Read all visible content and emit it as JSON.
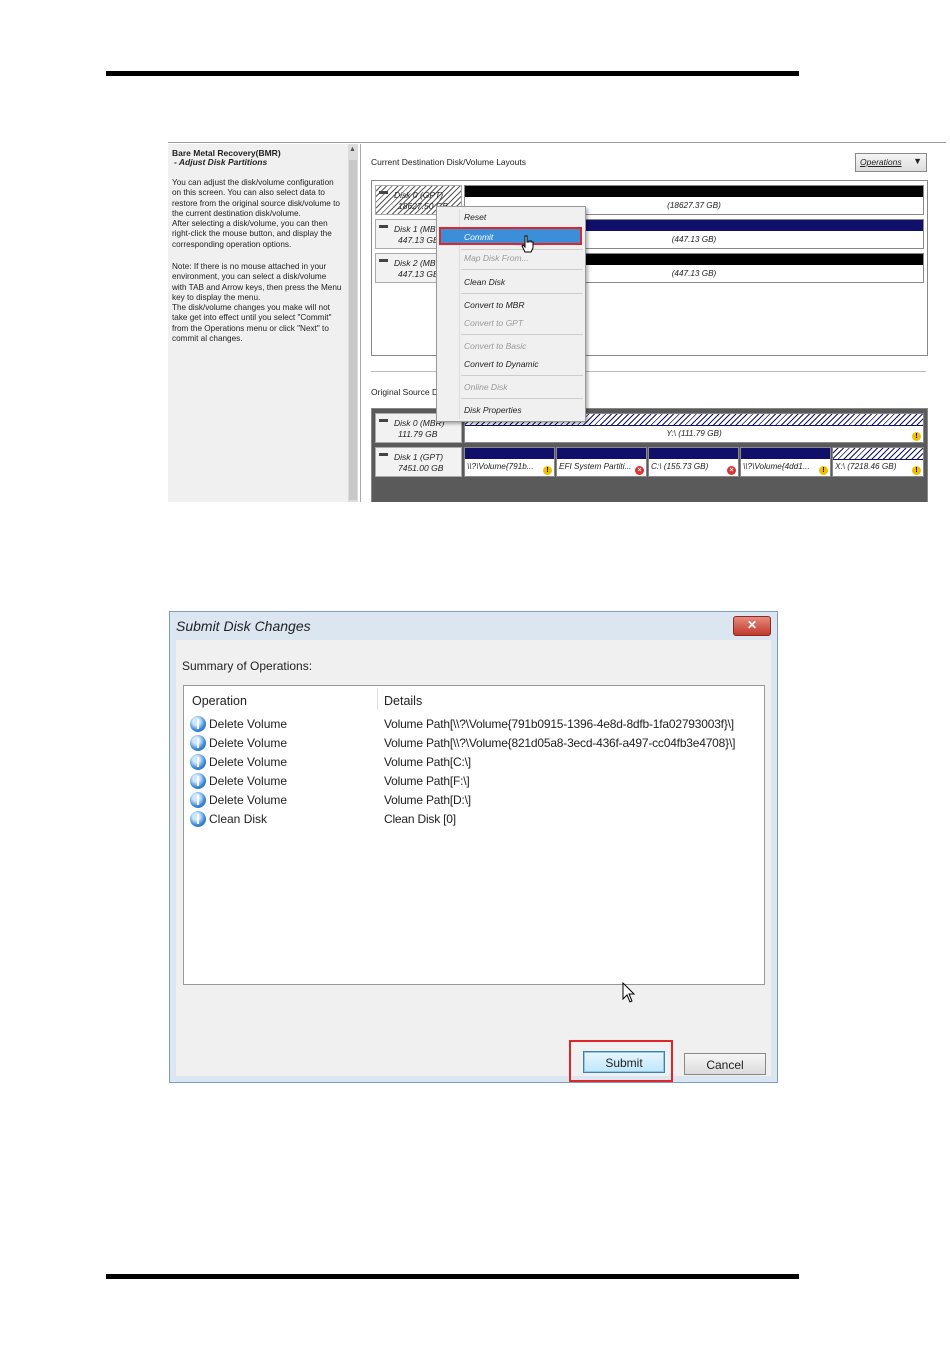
{
  "bmr": {
    "title": "Bare Metal Recovery(BMR)",
    "subtitle": "- Adjust Disk Partitions",
    "help1": "You can adjust the disk/volume configuration\non this screen. You can also select data to\nrestore from the original source disk/volume to\nthe current destination disk/volume.\nAfter selecting a disk/volume, you can then\nright-click the mouse button, and display the\ncorresponding operation options.",
    "help2": "Note: If there is no mouse attached in your\nenvironment, you can select a disk/volume\nwith TAB and Arrow keys, then press the Menu\nkey to display the menu.\nThe disk/volume changes you make will not\ntake get into effect until you select \"Commit\"\nfrom the Operations menu or click \"Next\" to\ncommit al changes.",
    "dest_label": "Current Destination Disk/Volume Layouts",
    "operations_label": "Operations",
    "source_label": "Original Source Di",
    "dest_disks": [
      {
        "name": "Disk 0 (GPT)",
        "size": "18627.50 GB",
        "volume": "(18627.37 GB)"
      },
      {
        "name": "Disk 1 (MB",
        "size": "447.13 GB",
        "volume": "(447.13 GB)"
      },
      {
        "name": "Disk 2 (MB",
        "size": "447.13 GB",
        "volume": "(447.13 GB)"
      }
    ],
    "source_disks": [
      {
        "name": "Disk 0 (MBR)",
        "size": "111.79 GB",
        "volumes": [
          "Y:\\ (111.79 GB)"
        ]
      },
      {
        "name": "Disk 1 (GPT)",
        "size": "7451.00 GB",
        "volumes": [
          "\\\\?\\Volume{791b...",
          "EFI System Partiti...",
          "C:\\ (155.73 GB)",
          "\\\\?\\Volume{4dd1...",
          "X:\\ (7218.46 GB)"
        ]
      }
    ],
    "context_menu": [
      {
        "label": "Reset",
        "enabled": true
      },
      {
        "label": "Commit",
        "enabled": true,
        "selected": true
      },
      {
        "label": "Map Disk From...",
        "enabled": false
      },
      {
        "label": "Clean Disk",
        "enabled": true
      },
      {
        "label": "Convert to MBR",
        "enabled": true
      },
      {
        "label": "Convert to GPT",
        "enabled": false
      },
      {
        "label": "Convert to Basic",
        "enabled": false
      },
      {
        "label": "Convert to Dynamic",
        "enabled": true
      },
      {
        "label": "Online Disk",
        "enabled": false
      },
      {
        "label": "Disk Properties",
        "enabled": true
      }
    ]
  },
  "dialog": {
    "title": "Submit Disk Changes",
    "close_glyph": "✕",
    "summary_label": "Summary of Operations:",
    "col_operation": "Operation",
    "col_details": "Details",
    "rows": [
      {
        "operation": "Delete Volume",
        "details": "Volume Path[\\\\?\\Volume{791b0915-1396-4e8d-8dfb-1fa02793003f}\\]"
      },
      {
        "operation": "Delete Volume",
        "details": "Volume Path[\\\\?\\Volume{821d05a8-3ecd-436f-a497-cc04fb3e4708}\\]"
      },
      {
        "operation": "Delete Volume",
        "details": "Volume Path[C:\\]"
      },
      {
        "operation": "Delete Volume",
        "details": "Volume Path[F:\\]"
      },
      {
        "operation": "Delete Volume",
        "details": "Volume Path[D:\\]"
      },
      {
        "operation": "Clean Disk",
        "details": "Clean Disk [0]"
      }
    ],
    "submit_label": "Submit",
    "cancel_label": "Cancel",
    "highlight_color": "#e0252b"
  }
}
